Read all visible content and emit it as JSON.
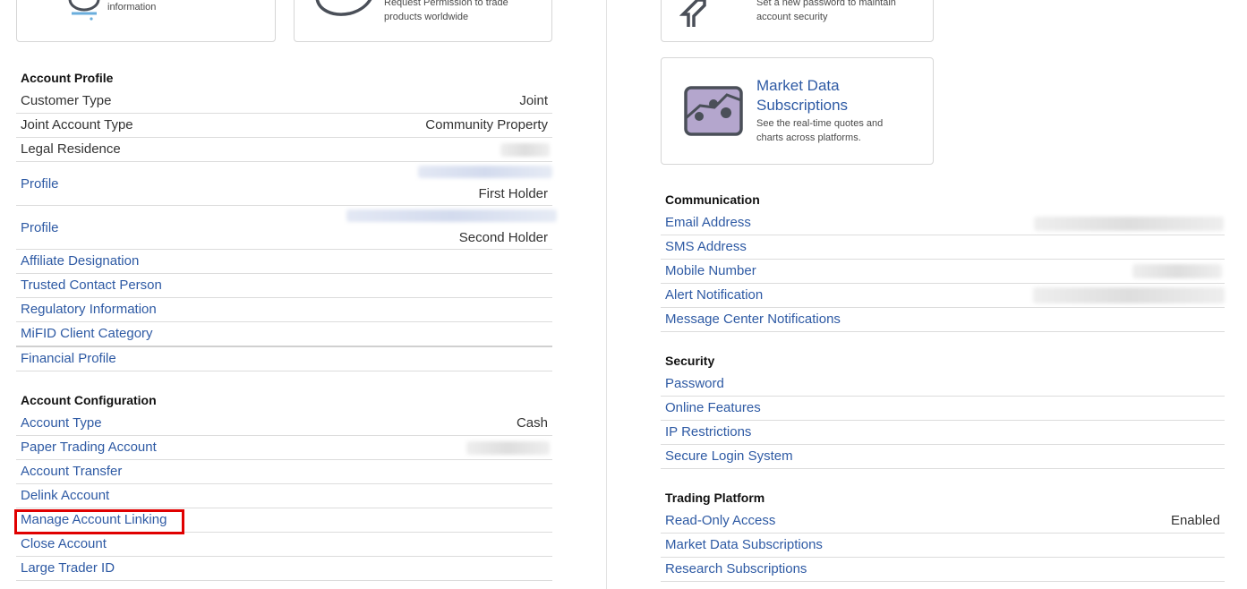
{
  "left_cards": [
    {
      "desc_line": "information"
    },
    {
      "desc_line1": "Request Permission to trade",
      "desc_line2": "products worldwide"
    }
  ],
  "right_cards": [
    {
      "desc_line1": "Set a new password to maintain",
      "desc_line2": "account security"
    },
    {
      "title_line1": "Market Data",
      "title_line2": "Subscriptions",
      "desc_line1": "See the real-time quotes and",
      "desc_line2": "charts across platforms."
    }
  ],
  "account_profile": {
    "title": "Account Profile",
    "customer_type": {
      "label": "Customer Type",
      "value": "Joint"
    },
    "joint_account_type": {
      "label": "Joint Account Type",
      "value": "Community Property"
    },
    "legal_residence": {
      "label": "Legal Residence"
    },
    "profile_1": {
      "label": "Profile",
      "value": "First Holder"
    },
    "profile_2": {
      "label": "Profile",
      "value": "Second Holder"
    },
    "affiliate": {
      "label": "Affiliate Designation"
    },
    "trusted": {
      "label": "Trusted Contact Person"
    },
    "regulatory": {
      "label": "Regulatory Information"
    },
    "mifid": {
      "label": "MiFID Client Category"
    },
    "financial": {
      "label": "Financial Profile"
    }
  },
  "account_configuration": {
    "title": "Account Configuration",
    "account_type": {
      "label": "Account Type",
      "value": "Cash"
    },
    "paper_trading": {
      "label": "Paper Trading Account"
    },
    "account_transfer": {
      "label": "Account Transfer"
    },
    "delink": {
      "label": "Delink Account"
    },
    "manage_linking": {
      "label": "Manage Account Linking"
    },
    "close": {
      "label": "Close Account"
    },
    "large_trader": {
      "label": "Large Trader ID"
    }
  },
  "communication": {
    "title": "Communication",
    "email": {
      "label": "Email Address"
    },
    "sms": {
      "label": "SMS Address"
    },
    "mobile": {
      "label": "Mobile Number"
    },
    "alert": {
      "label": "Alert Notification"
    },
    "message_center": {
      "label": "Message Center Notifications"
    }
  },
  "security": {
    "title": "Security",
    "password": {
      "label": "Password"
    },
    "online_features": {
      "label": "Online Features"
    },
    "ip_restrictions": {
      "label": "IP Restrictions"
    },
    "secure_login": {
      "label": "Secure Login System"
    }
  },
  "trading_platform": {
    "title": "Trading Platform",
    "read_only": {
      "label": "Read-Only Access",
      "value": "Enabled"
    },
    "market_data": {
      "label": "Market Data Subscriptions"
    },
    "research": {
      "label": "Research Subscriptions"
    }
  },
  "colors": {
    "link": "#2e5aa4",
    "highlight": "#e00000",
    "divider": "#dcdcdc"
  }
}
